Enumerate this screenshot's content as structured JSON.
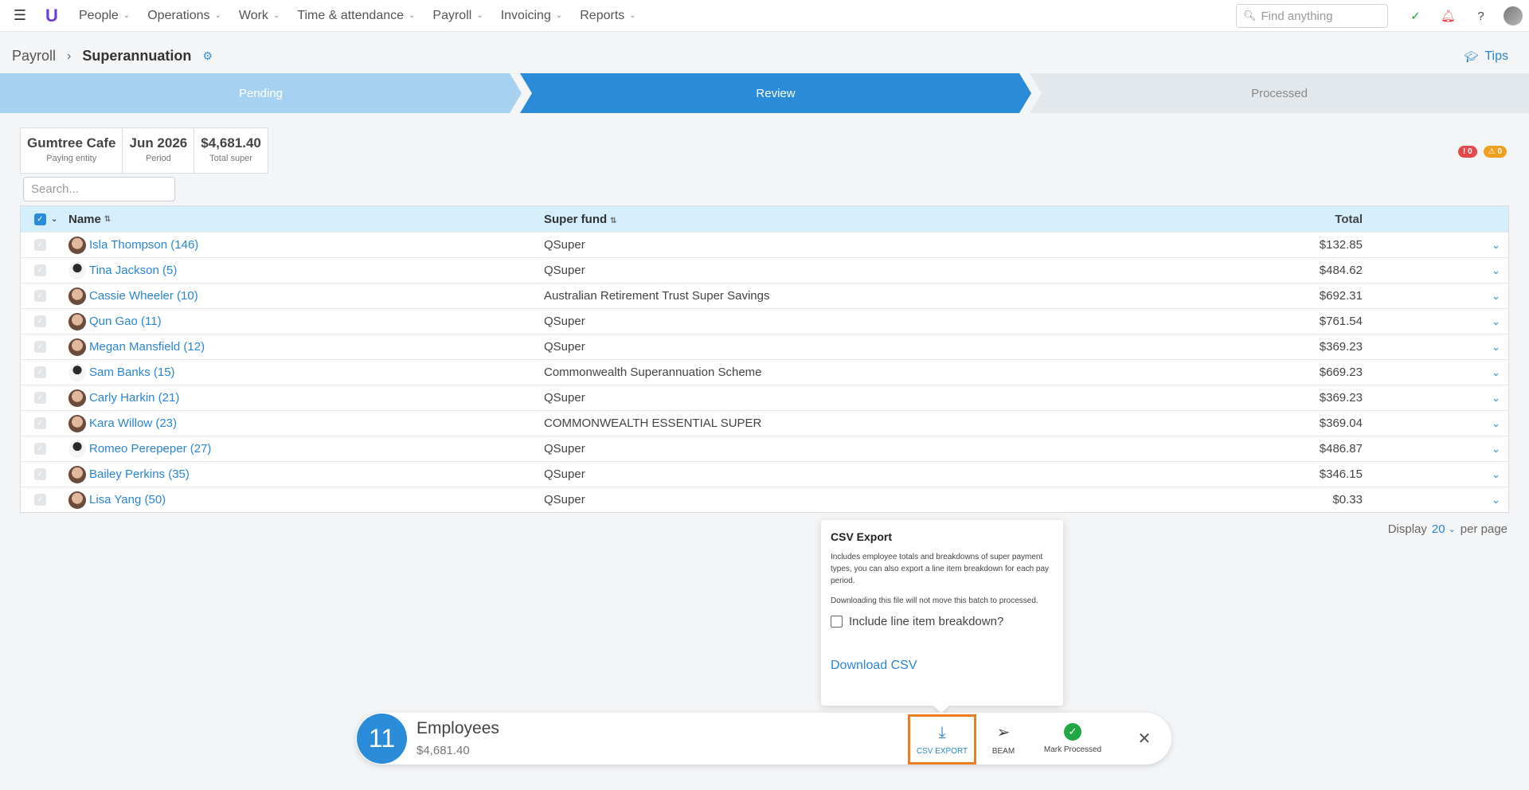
{
  "topnav": {
    "items": [
      {
        "label": "People"
      },
      {
        "label": "Operations"
      },
      {
        "label": "Work"
      },
      {
        "label": "Time & attendance"
      },
      {
        "label": "Payroll"
      },
      {
        "label": "Invoicing"
      },
      {
        "label": "Reports"
      }
    ],
    "search_placeholder": "Find anything"
  },
  "breadcrumb": {
    "root": "Payroll",
    "current": "Superannuation"
  },
  "tips_label": "Tips",
  "stepper": {
    "steps": [
      {
        "label": "Pending"
      },
      {
        "label": "Review"
      },
      {
        "label": "Processed"
      }
    ]
  },
  "summary": [
    {
      "value": "Gumtree Cafe",
      "label": "Paying entity"
    },
    {
      "value": "Jun 2026",
      "label": "Period"
    },
    {
      "value": "$4,681.40",
      "label": "Total super"
    }
  ],
  "badges": {
    "errors": "0",
    "warnings": "0"
  },
  "table_search_placeholder": "Search...",
  "table": {
    "headers": {
      "name": "Name",
      "fund": "Super fund",
      "total": "Total"
    },
    "rows": [
      {
        "name": "Isla Thompson (146)",
        "fund": "QSuper",
        "total": "$132.85"
      },
      {
        "name": "Tina Jackson (5)",
        "fund": "QSuper",
        "total": "$484.62"
      },
      {
        "name": "Cassie Wheeler (10)",
        "fund": "Australian Retirement Trust Super Savings",
        "total": "$692.31"
      },
      {
        "name": "Qun Gao (11)",
        "fund": "QSuper",
        "total": "$761.54"
      },
      {
        "name": "Megan Mansfield (12)",
        "fund": "QSuper",
        "total": "$369.23"
      },
      {
        "name": "Sam Banks (15)",
        "fund": "Commonwealth Superannuation Scheme",
        "total": "$669.23"
      },
      {
        "name": "Carly Harkin (21)",
        "fund": "QSuper",
        "total": "$369.23"
      },
      {
        "name": "Kara Willow (23)",
        "fund": "COMMONWEALTH ESSENTIAL SUPER",
        "total": "$369.04"
      },
      {
        "name": "Romeo Perepeper (27)",
        "fund": "QSuper",
        "total": "$486.87"
      },
      {
        "name": "Bailey Perkins (35)",
        "fund": "QSuper",
        "total": "$346.15"
      },
      {
        "name": "Lisa Yang (50)",
        "fund": "QSuper",
        "total": "$0.33"
      }
    ]
  },
  "pagination": {
    "prefix": "Display",
    "value": "20",
    "suffix": "per page"
  },
  "popover": {
    "title": "CSV Export",
    "text1": "Includes employee totals and breakdowns of super payment types, you can also export a line item breakdown for each pay period.",
    "text2": "Downloading this file will not move this batch to processed.",
    "checkbox_label": "Include line item breakdown?",
    "link": "Download CSV"
  },
  "actionbar": {
    "count": "11",
    "title": "Employees",
    "subtitle": "$4,681.40",
    "csv_label": "CSV EXPORT",
    "beam_label": "BEAM",
    "mark_label": "Mark Processed"
  }
}
